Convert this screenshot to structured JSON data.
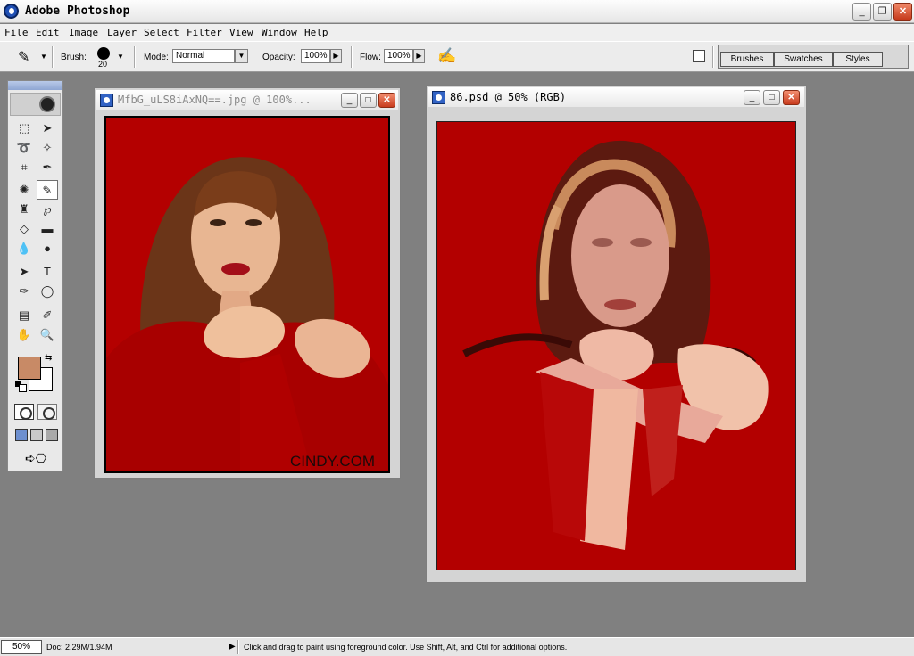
{
  "app": {
    "title": "Adobe Photoshop",
    "icon": "photoshop-eye-icon"
  },
  "window_controls": {
    "minimize": "_",
    "maximize": "❐",
    "close": "✕"
  },
  "menu": [
    "File",
    "Edit",
    "Image",
    "Layer",
    "Select",
    "Filter",
    "View",
    "Window",
    "Help"
  ],
  "options_bar": {
    "brush_label": "Brush:",
    "brush_size": "20",
    "mode_label": "Mode:",
    "mode_value": "Normal",
    "opacity_label": "Opacity:",
    "opacity_value": "100%",
    "flow_label": "Flow:",
    "flow_value": "100%"
  },
  "palette_well": {
    "tabs": [
      "Brushes",
      "Swatches",
      "Styles"
    ]
  },
  "toolbox": {
    "foreground_color": "#c88a66",
    "background_color": "#ffffff"
  },
  "documents": [
    {
      "title": "MfbG_uLS8iAxNQ==.jpg @ 100%...",
      "watermark": "CINDY.COM"
    },
    {
      "title": "86.psd @ 50% (RGB)"
    }
  ],
  "status_bar": {
    "zoom": "50%",
    "doc_size": "Doc: 2.29M/1.94M",
    "hint": "Click and drag to paint using foreground color.  Use Shift, Alt, and Ctrl for additional options."
  },
  "colors": {
    "canvas_red": "#b30000",
    "workspace_gray": "#808080"
  }
}
